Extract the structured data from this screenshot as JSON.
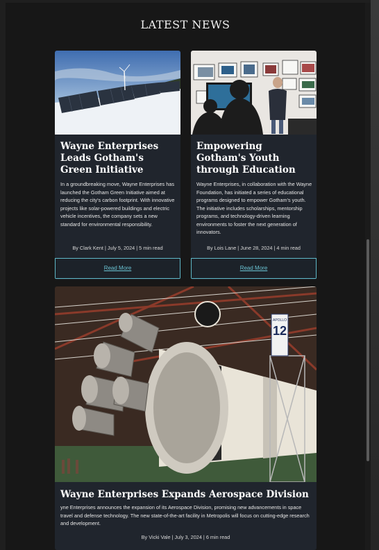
{
  "section": {
    "title": "LATEST NEWS"
  },
  "articles": [
    {
      "title": "Wayne Enterprises Leads Gotham's Green Initiative",
      "body": "In a groundbreaking move, Wayne Enterprises has launched the Gotham Green Initiative aimed at reducing the city's carbon footprint. With innovative projects like solar-powered buildings and electric vehicle incentives, the company sets a new standard for environmental responsibility.",
      "meta": "By Clark Kent | July 5, 2024 | 5 min read",
      "button": "Read More",
      "image": "solar-panels-wind-turbine-snow"
    },
    {
      "title": "Empowering Gotham's Youth through Education",
      "body": "Wayne Enterprises, in collaboration with the Wayne Foundation, has initiated a series of educational programs designed to empower Gotham's youth. The initiative includes scholarships, mentorship programs, and technology-driven learning environments to foster the next generation of innovators.",
      "meta": "By Lois Lane | June 28, 2024 | 4 min read",
      "button": "Read More",
      "image": "classroom-presentation"
    },
    {
      "title": "Wayne Enterprises Expands Aerospace Division",
      "body": "yne Enterprises announces the expansion of its Aerospace Division, promising new advancements in space travel and defense technology. The new state-of-the-art facility in Metropolis will focus on cutting-edge research and development.",
      "meta": "By Vicki Vale | July 3, 2024 | 6 min read",
      "image": "saturn-rocket-engines-hangar",
      "rocket_text": "APOLLO",
      "rocket_number": "12"
    }
  ],
  "colors": {
    "page_bg": "#171717",
    "card_bg": "#20252d",
    "accent": "#5fb8c8"
  }
}
